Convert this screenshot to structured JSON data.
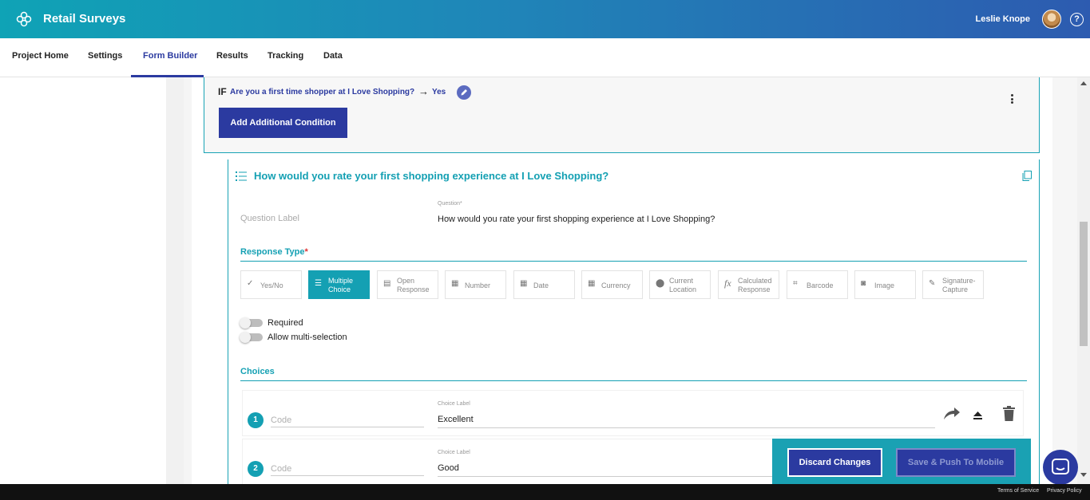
{
  "header": {
    "app_title": "Retail Surveys",
    "user_name": "Leslie Knope",
    "help_glyph": "?",
    "colors": {
      "gradient_start": "#0fa3b6",
      "gradient_end": "#2d5bb0"
    }
  },
  "nav": {
    "tabs": [
      {
        "label": "Project Home"
      },
      {
        "label": "Settings"
      },
      {
        "label": "Form Builder",
        "active": true
      },
      {
        "label": "Results"
      },
      {
        "label": "Tracking"
      },
      {
        "label": "Data"
      }
    ]
  },
  "condition": {
    "if_label": "IF",
    "question": "Are you a first time shopper at I Love Shopping?",
    "arrow": "→",
    "answer": "Yes",
    "add_button": "Add Additional Condition"
  },
  "question_block": {
    "title": "How would you rate your first shopping experience at I Love Shopping?",
    "question_label_placeholder": "Question Label",
    "question_field_label": "Question*",
    "question_value": "How would you rate your first shopping experience at I Love Shopping?"
  },
  "response_type": {
    "label": "Response Type",
    "required_marker": "*",
    "options": [
      {
        "label": "Yes/No",
        "icon": "yes-no-icon",
        "glyph": "✓"
      },
      {
        "label": "Multiple Choice",
        "icon": "list-icon",
        "glyph": "☰",
        "active": true
      },
      {
        "label": "Open Response",
        "icon": "text-icon",
        "glyph": "▤"
      },
      {
        "label": "Number",
        "icon": "number-icon",
        "glyph": "▦"
      },
      {
        "label": "Date",
        "icon": "calendar-icon",
        "glyph": "▦"
      },
      {
        "label": "Currency",
        "icon": "currency-icon",
        "glyph": "▦"
      },
      {
        "label": "Current Location",
        "icon": "location-icon",
        "glyph": "⬤"
      },
      {
        "label": "Calculated Response",
        "icon": "function-icon",
        "glyph": "fx"
      },
      {
        "label": "Barcode",
        "icon": "barcode-icon",
        "glyph": "⌗"
      },
      {
        "label": "Image",
        "icon": "camera-icon",
        "glyph": "◙"
      },
      {
        "label": "Signature-Capture",
        "icon": "pen-icon",
        "glyph": "✎"
      }
    ]
  },
  "toggles": {
    "required_label": "Required",
    "multi_label": "Allow multi-selection"
  },
  "choices": {
    "label": "Choices",
    "items": [
      {
        "number": "1",
        "code_placeholder": "Code",
        "label_caption": "Choice Label",
        "value": "Excellent"
      },
      {
        "number": "2",
        "code_placeholder": "Code",
        "label_caption": "Choice Label",
        "value": "Good"
      }
    ]
  },
  "actions": {
    "discard": "Discard Changes",
    "save": "Save & Push To Mobile"
  },
  "footer": {
    "terms": "Terms of Service",
    "privacy": "Privacy Policy"
  }
}
